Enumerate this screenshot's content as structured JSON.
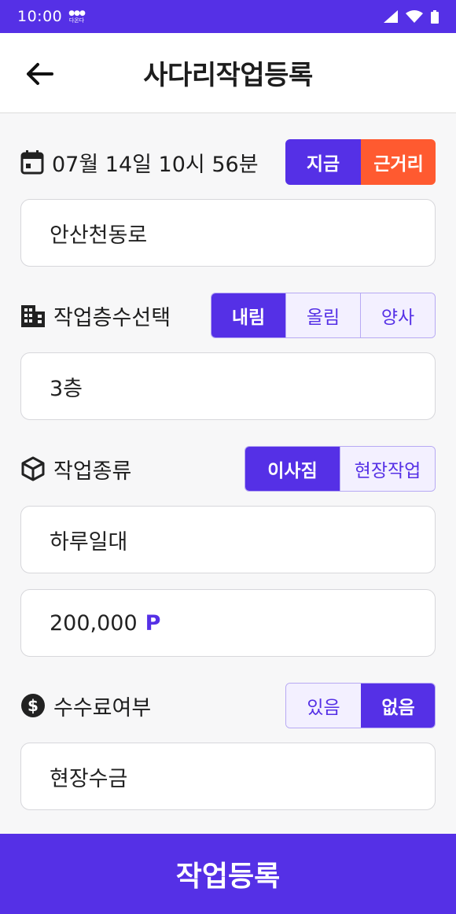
{
  "status_bar": {
    "time": "10:00",
    "app_badge_top": "●●●",
    "app_badge_bottom": "다온다"
  },
  "header": {
    "title": "사다리작업등록"
  },
  "datetime": {
    "value": "07월 14일 10시 56분",
    "options": [
      {
        "label": "지금",
        "state": "active"
      },
      {
        "label": "근거리",
        "state": "accent"
      }
    ]
  },
  "address": {
    "value": "안산천동로"
  },
  "floor": {
    "label": "작업층수선택",
    "options": [
      {
        "label": "내림",
        "state": "active"
      },
      {
        "label": "올림",
        "state": "inactive"
      },
      {
        "label": "양사",
        "state": "inactive"
      }
    ],
    "value": "3층"
  },
  "work_type": {
    "label": "작업종류",
    "options": [
      {
        "label": "이사짐",
        "state": "active"
      },
      {
        "label": "현장작업",
        "state": "inactive"
      }
    ],
    "duration_value": "하루일대"
  },
  "price": {
    "value": "200,000",
    "unit": "P"
  },
  "fee": {
    "label": "수수료여부",
    "options": [
      {
        "label": "있음",
        "state": "inactive"
      },
      {
        "label": "없음",
        "state": "active"
      }
    ],
    "payment_value": "현장수금"
  },
  "submit": {
    "label": "작업등록"
  },
  "colors": {
    "primary": "#5530e6",
    "accent": "#ff5a30",
    "background": "#f7f7f8"
  }
}
